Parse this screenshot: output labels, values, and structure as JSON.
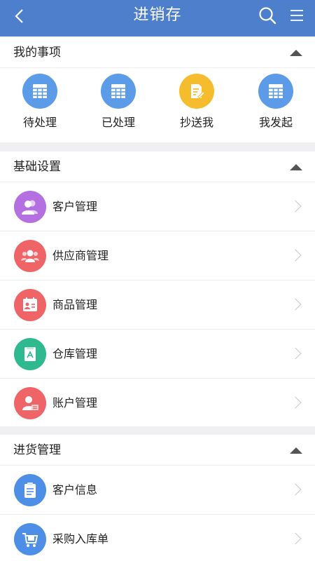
{
  "header": {
    "title": "进销存",
    "back_icon": "chevron-left-icon",
    "search_icon": "search-icon",
    "menu_icon": "hamburger-menu-icon",
    "color": "#4d7fcc"
  },
  "my_items": {
    "title": "我的事项",
    "items": [
      {
        "label": "待处理",
        "icon": "grid-table-icon",
        "color": "#5b9be8"
      },
      {
        "label": "已处理",
        "icon": "grid-table-icon",
        "color": "#5b9be8"
      },
      {
        "label": "抄送我",
        "icon": "document-edit-icon",
        "color": "#f5bd2e"
      },
      {
        "label": "我发起",
        "icon": "grid-table-icon",
        "color": "#5b9be8"
      }
    ]
  },
  "basic_settings": {
    "title": "基础设置",
    "items": [
      {
        "label": "客户管理",
        "icon": "users-icon",
        "color": "#b46fe0"
      },
      {
        "label": "供应商管理",
        "icon": "group-icon",
        "color": "#ef6466"
      },
      {
        "label": "商品管理",
        "icon": "product-card-icon",
        "color": "#ef6466"
      },
      {
        "label": "仓库管理",
        "icon": "warehouse-doc-icon",
        "color": "#2fb98f"
      },
      {
        "label": "账户管理",
        "icon": "account-user-icon",
        "color": "#ef6466"
      }
    ]
  },
  "purchase": {
    "title": "进货管理",
    "items": [
      {
        "label": "客户信息",
        "icon": "clipboard-icon",
        "color": "#4d8ee6"
      },
      {
        "label": "采购入库单",
        "icon": "cart-icon",
        "color": "#4d8ee6"
      }
    ]
  }
}
